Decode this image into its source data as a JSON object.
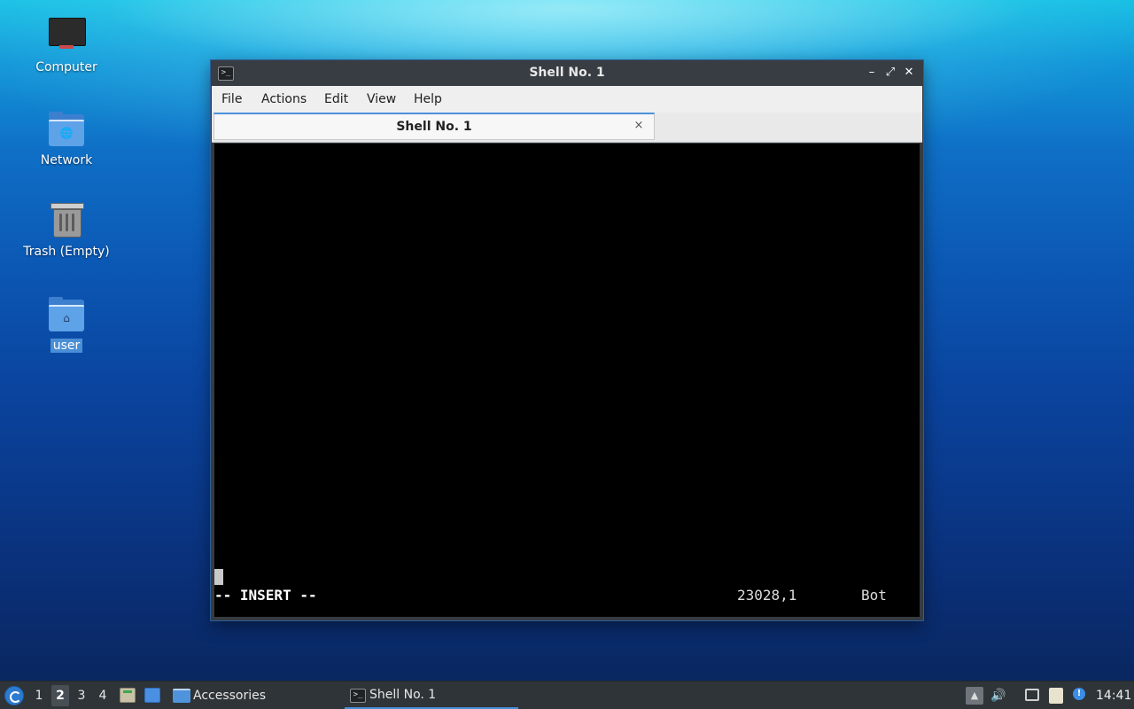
{
  "desktop": {
    "icons": [
      {
        "label": "Computer",
        "icon": "computer-icon"
      },
      {
        "label": "Network",
        "icon": "network-folder-icon"
      },
      {
        "label": "Trash (Empty)",
        "icon": "trash-icon"
      },
      {
        "label": "user",
        "icon": "home-folder-icon",
        "selected": true
      }
    ]
  },
  "window": {
    "title": "Shell No. 1",
    "controls": {
      "minimize": "–",
      "maximize": "⤢",
      "close": "✕"
    },
    "menu": [
      "File",
      "Actions",
      "Edit",
      "View",
      "Help"
    ],
    "tab": {
      "label": "Shell No. 1",
      "close": "×"
    },
    "terminal": {
      "mode_line": "-- INSERT --",
      "position": "23028,1",
      "scroll": "Bot"
    }
  },
  "taskbar": {
    "workspaces": [
      "1",
      "2",
      "3",
      "4"
    ],
    "active_workspace": "2",
    "places_label": "Accessories",
    "task_label": "Shell No. 1",
    "clock": "14:41"
  },
  "colors": {
    "accent": "#4a90d9",
    "terminal_bg": "#000000",
    "titlebar": "#373d42",
    "taskbar": "#2f3438"
  }
}
